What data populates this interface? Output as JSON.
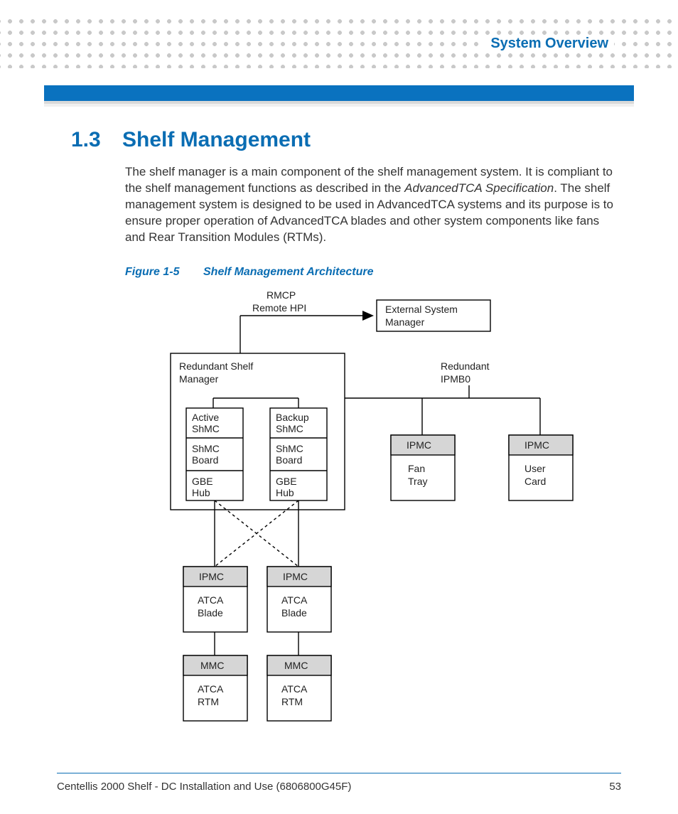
{
  "header": {
    "chapter_label": "System Overview"
  },
  "section": {
    "number": "1.3",
    "title": "Shelf Management",
    "paragraph_pre_em": "The shelf manager is a main component of the shelf management system. It is compliant to the shelf management functions as described in the ",
    "paragraph_em": "AdvancedTCA Specification",
    "paragraph_post_em": ". The shelf management system is designed to be used in AdvancedTCA systems and its purpose is to ensure proper operation of AdvancedTCA blades and other system components like fans and Rear Transition Modules (RTMs)."
  },
  "figure": {
    "label": "Figure 1-5",
    "title": "Shelf Management Architecture"
  },
  "diagram": {
    "rmcp_line1": "RMCP",
    "rmcp_line2": "Remote HPI",
    "external_sys_mgr_line1": "External System",
    "external_sys_mgr_line2": "Manager",
    "redundant_shmgr_line1": "Redundant Shelf",
    "redundant_shmgr_line2": "Manager",
    "redundant_ipmb_line1": "Redundant",
    "redundant_ipmb_line2": "IPMB0",
    "active_shmc_line1": "Active",
    "active_shmc_line2": "ShMC",
    "backup_shmc_line1": "Backup",
    "backup_shmc_line2": "ShMC",
    "shmc_board_line1": "ShMC",
    "shmc_board_line2": "Board",
    "gbe_hub_line1": "GBE",
    "gbe_hub_line2": "Hub",
    "ipmc": "IPMC",
    "fan_tray_line1": "Fan",
    "fan_tray_line2": "Tray",
    "user_card_line1": "User",
    "user_card_line2": "Card",
    "atca_blade_line1": "ATCA",
    "atca_blade_line2": "Blade",
    "mmc": "MMC",
    "atca_rtm_line1": "ATCA",
    "atca_rtm_line2": "RTM"
  },
  "footer": {
    "doc_title": "Centellis 2000 Shelf - DC Installation and Use (6806800G45F)",
    "page_number": "53"
  }
}
